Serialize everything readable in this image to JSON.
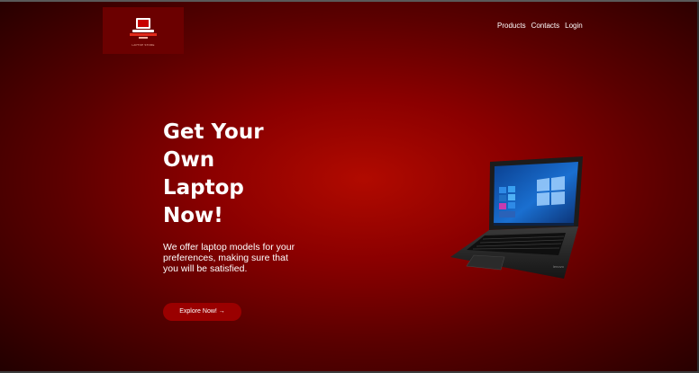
{
  "header": {
    "logo_text": "LAPTOP STORE",
    "nav": [
      {
        "label": "Products"
      },
      {
        "label": "Contacts"
      },
      {
        "label": "Login"
      }
    ]
  },
  "hero": {
    "title_lines": [
      "Get Your",
      "Own",
      "Laptop",
      "Now!"
    ],
    "description": "We offer laptop models for your preferences, making sure that you will be satisfied.",
    "cta_label": "Explore Now! →"
  },
  "colors": {
    "brand_red": "#9a0000",
    "background_center": "#b10a00",
    "background_edge": "#220000",
    "text": "#ffffff"
  },
  "icons": {
    "logo": "laptop-icon",
    "product_image": "laptop-image"
  }
}
